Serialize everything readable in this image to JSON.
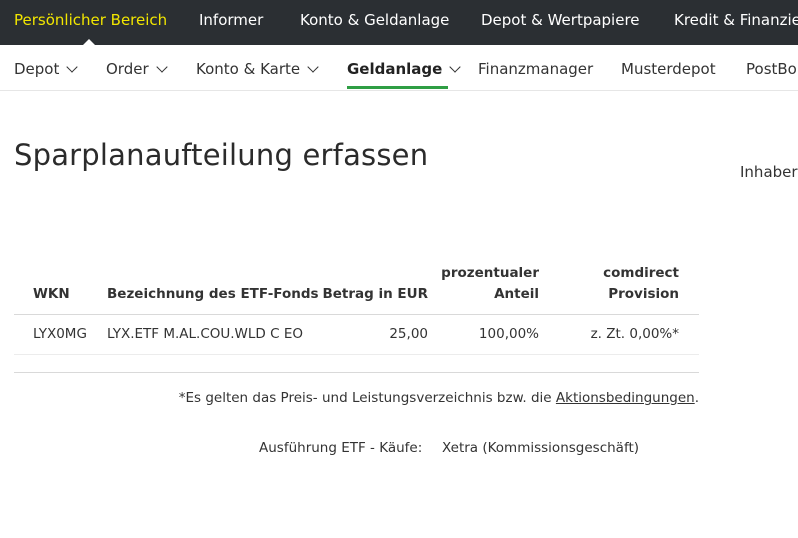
{
  "topnav": {
    "items": [
      {
        "label": "Persönlicher Bereich",
        "active": true
      },
      {
        "label": "Informer"
      },
      {
        "label": "Konto & Geldanlage"
      },
      {
        "label": "Depot & Wertpapiere"
      },
      {
        "label": "Kredit & Finanzie"
      }
    ],
    "accent_color": "#f2e600",
    "background_color": "#2b2f33"
  },
  "subnav": {
    "items": [
      {
        "label": "Depot",
        "dropdown": true
      },
      {
        "label": "Order",
        "dropdown": true
      },
      {
        "label": "Konto & Karte",
        "dropdown": true
      },
      {
        "label": "Geldanlage",
        "dropdown": true,
        "active": true
      },
      {
        "label": "Finanzmanager"
      },
      {
        "label": "Musterdepot"
      },
      {
        "label": "PostBo"
      }
    ],
    "active_underline_color": "#2f9e44"
  },
  "page": {
    "title": "Sparplanaufteilung erfassen",
    "side_label": "Inhaber"
  },
  "table": {
    "headers": {
      "wkn": "WKN",
      "name": "Bezeichnung des ETF-Fonds",
      "amount": "Betrag in EUR",
      "share_line1": "prozentualer",
      "share_line2": "Anteil",
      "provision_line1": "comdirect",
      "provision_line2": "Provision"
    },
    "rows": [
      {
        "wkn": "LYX0MG",
        "name": "LYX.ETF M.AL.COU.WLD C EO",
        "amount": "25,00",
        "share": "100,00%",
        "provision": "z. Zt. 0,00%*"
      }
    ]
  },
  "footnote": {
    "text": "*Es gelten das Preis- und Leistungsverzeichnis bzw. die ",
    "link": "Aktionsbedingungen",
    "end": "."
  },
  "execution": {
    "label": "Ausführung ETF - Käufe:",
    "value": "Xetra (Kommissionsgeschäft)"
  }
}
